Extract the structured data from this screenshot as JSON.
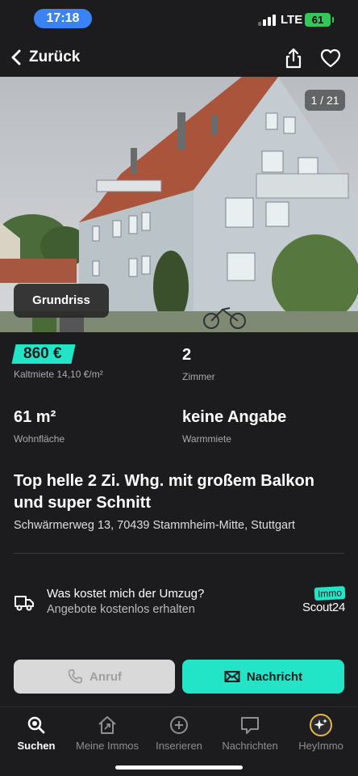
{
  "status_bar": {
    "time": "17:18",
    "network": "LTE",
    "battery": "61"
  },
  "nav": {
    "back_label": "Zurück"
  },
  "gallery": {
    "counter": "1 / 21",
    "floorplan_label": "Grundriss"
  },
  "facts": {
    "price": {
      "value": "860 €",
      "label": "Kaltmiete 14,10 €/m²"
    },
    "rooms": {
      "value": "2",
      "label": "Zimmer"
    },
    "area": {
      "value": "61 m²",
      "label": "Wohnfläche"
    },
    "warm_rent": {
      "value": "keine Angabe",
      "label": "Warmmiete"
    }
  },
  "listing": {
    "title": "Top helle 2 Zi. Whg. mit großem Balkon und super Schnitt",
    "address": "Schwärmerweg 13, 70439 Stammheim-Mitte, Stuttgart"
  },
  "promo": {
    "question": "Was kostet mich der Umzug?",
    "subtitle": "Angebote kostenlos erhalten",
    "logo_immo": "Immo",
    "logo_scout": "Scout24"
  },
  "actions": {
    "call_label": "Anruf",
    "message_label": "Nachricht"
  },
  "tabbar": {
    "items": [
      {
        "label": "Suchen",
        "icon": "search-icon",
        "active": true
      },
      {
        "label": "Meine Immos",
        "icon": "house-icon",
        "active": false
      },
      {
        "label": "Inserieren",
        "icon": "plus-circle-icon",
        "active": false
      },
      {
        "label": "Nachrichten",
        "icon": "chat-bubble-icon",
        "active": false
      },
      {
        "label": "HeyImmo",
        "icon": "sparkle-icon",
        "active": false
      }
    ]
  },
  "colors": {
    "accent": "#22e5c8",
    "background": "#1c1c1e",
    "time_pill": "#3b82f6",
    "battery": "#34c759"
  }
}
